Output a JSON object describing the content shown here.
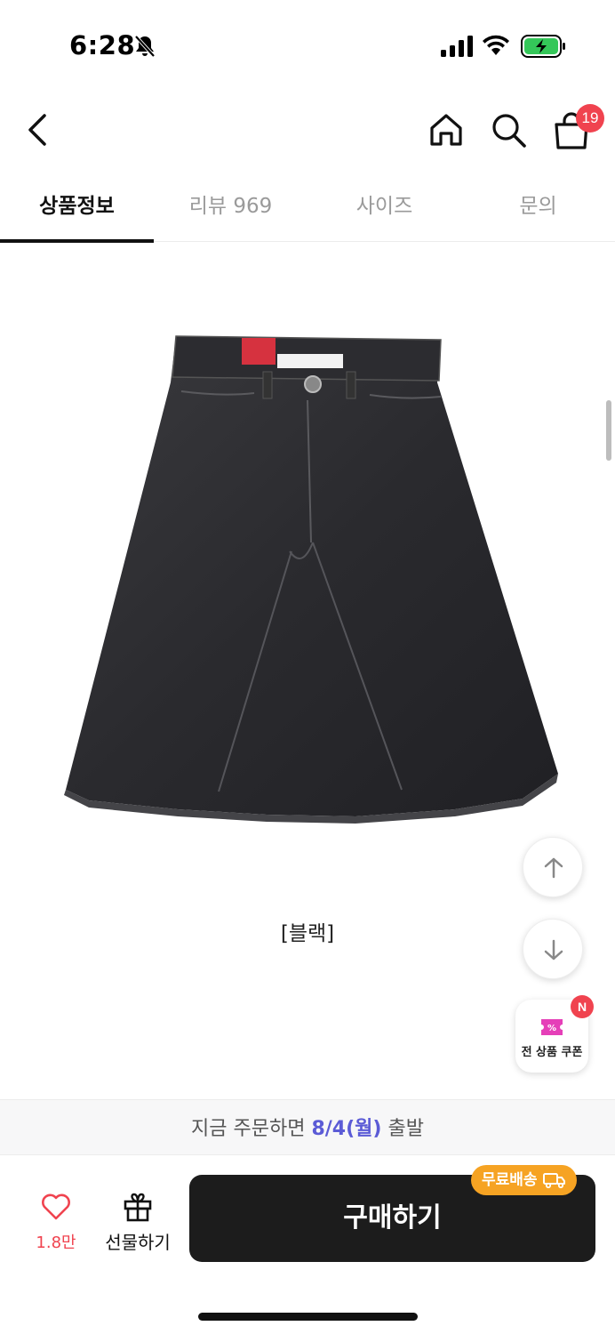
{
  "status_bar": {
    "time": "6:28"
  },
  "header": {
    "cart_count": "19"
  },
  "tabs": [
    {
      "label": "상품정보"
    },
    {
      "label": "리뷰 969"
    },
    {
      "label": "사이즈"
    },
    {
      "label": "문의"
    }
  ],
  "product": {
    "color_caption": "[블랙]"
  },
  "coupon": {
    "label": "전 상품 쿠폰",
    "badge": "N"
  },
  "shipping": {
    "prefix": "지금 주문하면 ",
    "date": "8/4(월)",
    "suffix": " 출발"
  },
  "actions": {
    "like_count": "1.8만",
    "gift_label": "선물하기",
    "buy_label": "구매하기",
    "free_shipping": "무료배송"
  },
  "colors": {
    "accent": "#f0434f",
    "ship_date": "#5b5bd6",
    "free_badge": "#f6a323",
    "buy_bg": "#1c1c1c"
  }
}
